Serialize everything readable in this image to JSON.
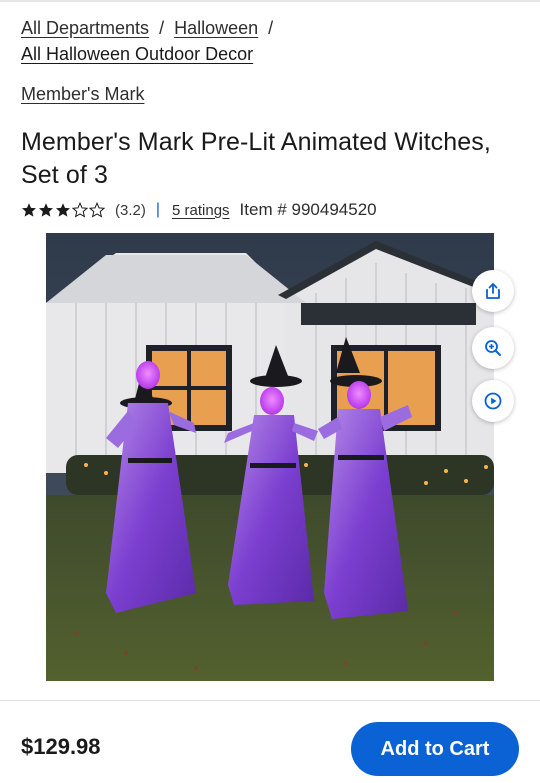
{
  "breadcrumb": {
    "items": [
      "All Departments",
      "Halloween",
      "All Halloween Outdoor Decor"
    ],
    "separator": "/"
  },
  "brand": "Member's Mark",
  "product": {
    "title": "Member's Mark Pre-Lit Animated Witches, Set of 3",
    "rating_stars": 3.2,
    "rating_text": "(3.2)",
    "ratings_link": "5 ratings",
    "item_number": "Item # 990494520",
    "image_alt": "Member's Mark Pre-Lit Animated Witches, Set of 3"
  },
  "image_actions": [
    {
      "name": "share-icon"
    },
    {
      "name": "zoom-in-icon"
    },
    {
      "name": "play-icon"
    }
  ],
  "cart": {
    "price": "$129.98",
    "add_label": "Add to Cart"
  },
  "colors": {
    "accent": "#0a62d4",
    "divider": "#1a5ed8",
    "witch_robe": "#8a4fd8",
    "witch_face": "#c93cff"
  }
}
